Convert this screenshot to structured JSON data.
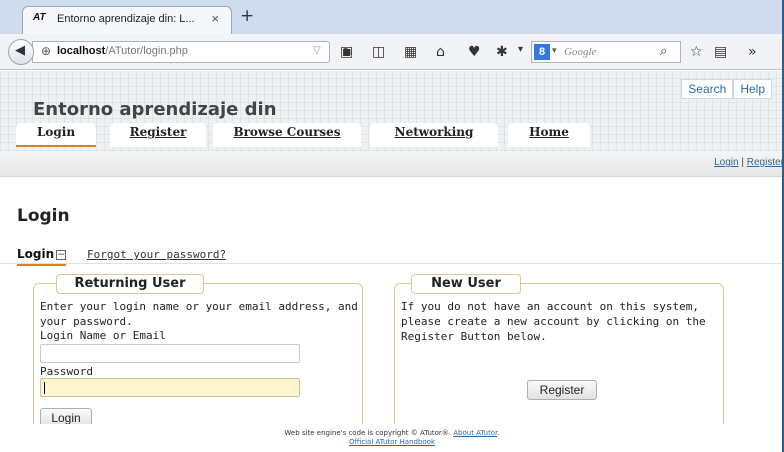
{
  "browser": {
    "tab_logo": "AT",
    "tab_title": "Entorno aprendizaje din: L...",
    "tab_close": "×",
    "new_tab": "+",
    "url_host": "localhost",
    "url_path": "/ATutor/login.php",
    "search_engine_letter": "8",
    "search_placeholder": "Google"
  },
  "site": {
    "top_links": [
      "Search",
      "Help"
    ],
    "title": "Entorno aprendizaje din",
    "nav_tabs": [
      "Login",
      "Register",
      "Browse Courses",
      "Networking",
      "Home"
    ],
    "active_tab": "Login",
    "sub_links": {
      "login": "Login",
      "separator": " | ",
      "register": "Register"
    }
  },
  "main": {
    "heading": "Login",
    "subnav_active": "Login",
    "subnav_toggle": "−",
    "forgot_link": "Forgot your password?"
  },
  "returning_user": {
    "legend": "Returning User",
    "instructions_line1": "Enter your login name or your email address, and",
    "instructions_line2": "your password.",
    "login_label": "Login Name or Email",
    "login_value": "",
    "password_label": "Password",
    "password_value": "",
    "submit": "Login"
  },
  "new_user": {
    "legend": "New User",
    "text_line1": "If you do not have an account on this system,",
    "text_line2": "please create a new account by clicking on the",
    "text_line3": "Register Button below.",
    "register_button": "Register"
  },
  "footer": {
    "copyright": "Web site engine's code is copyright © ATutor®.",
    "about_link": "About ATutor",
    "handbook_link": "Official ATutor Handbook"
  }
}
